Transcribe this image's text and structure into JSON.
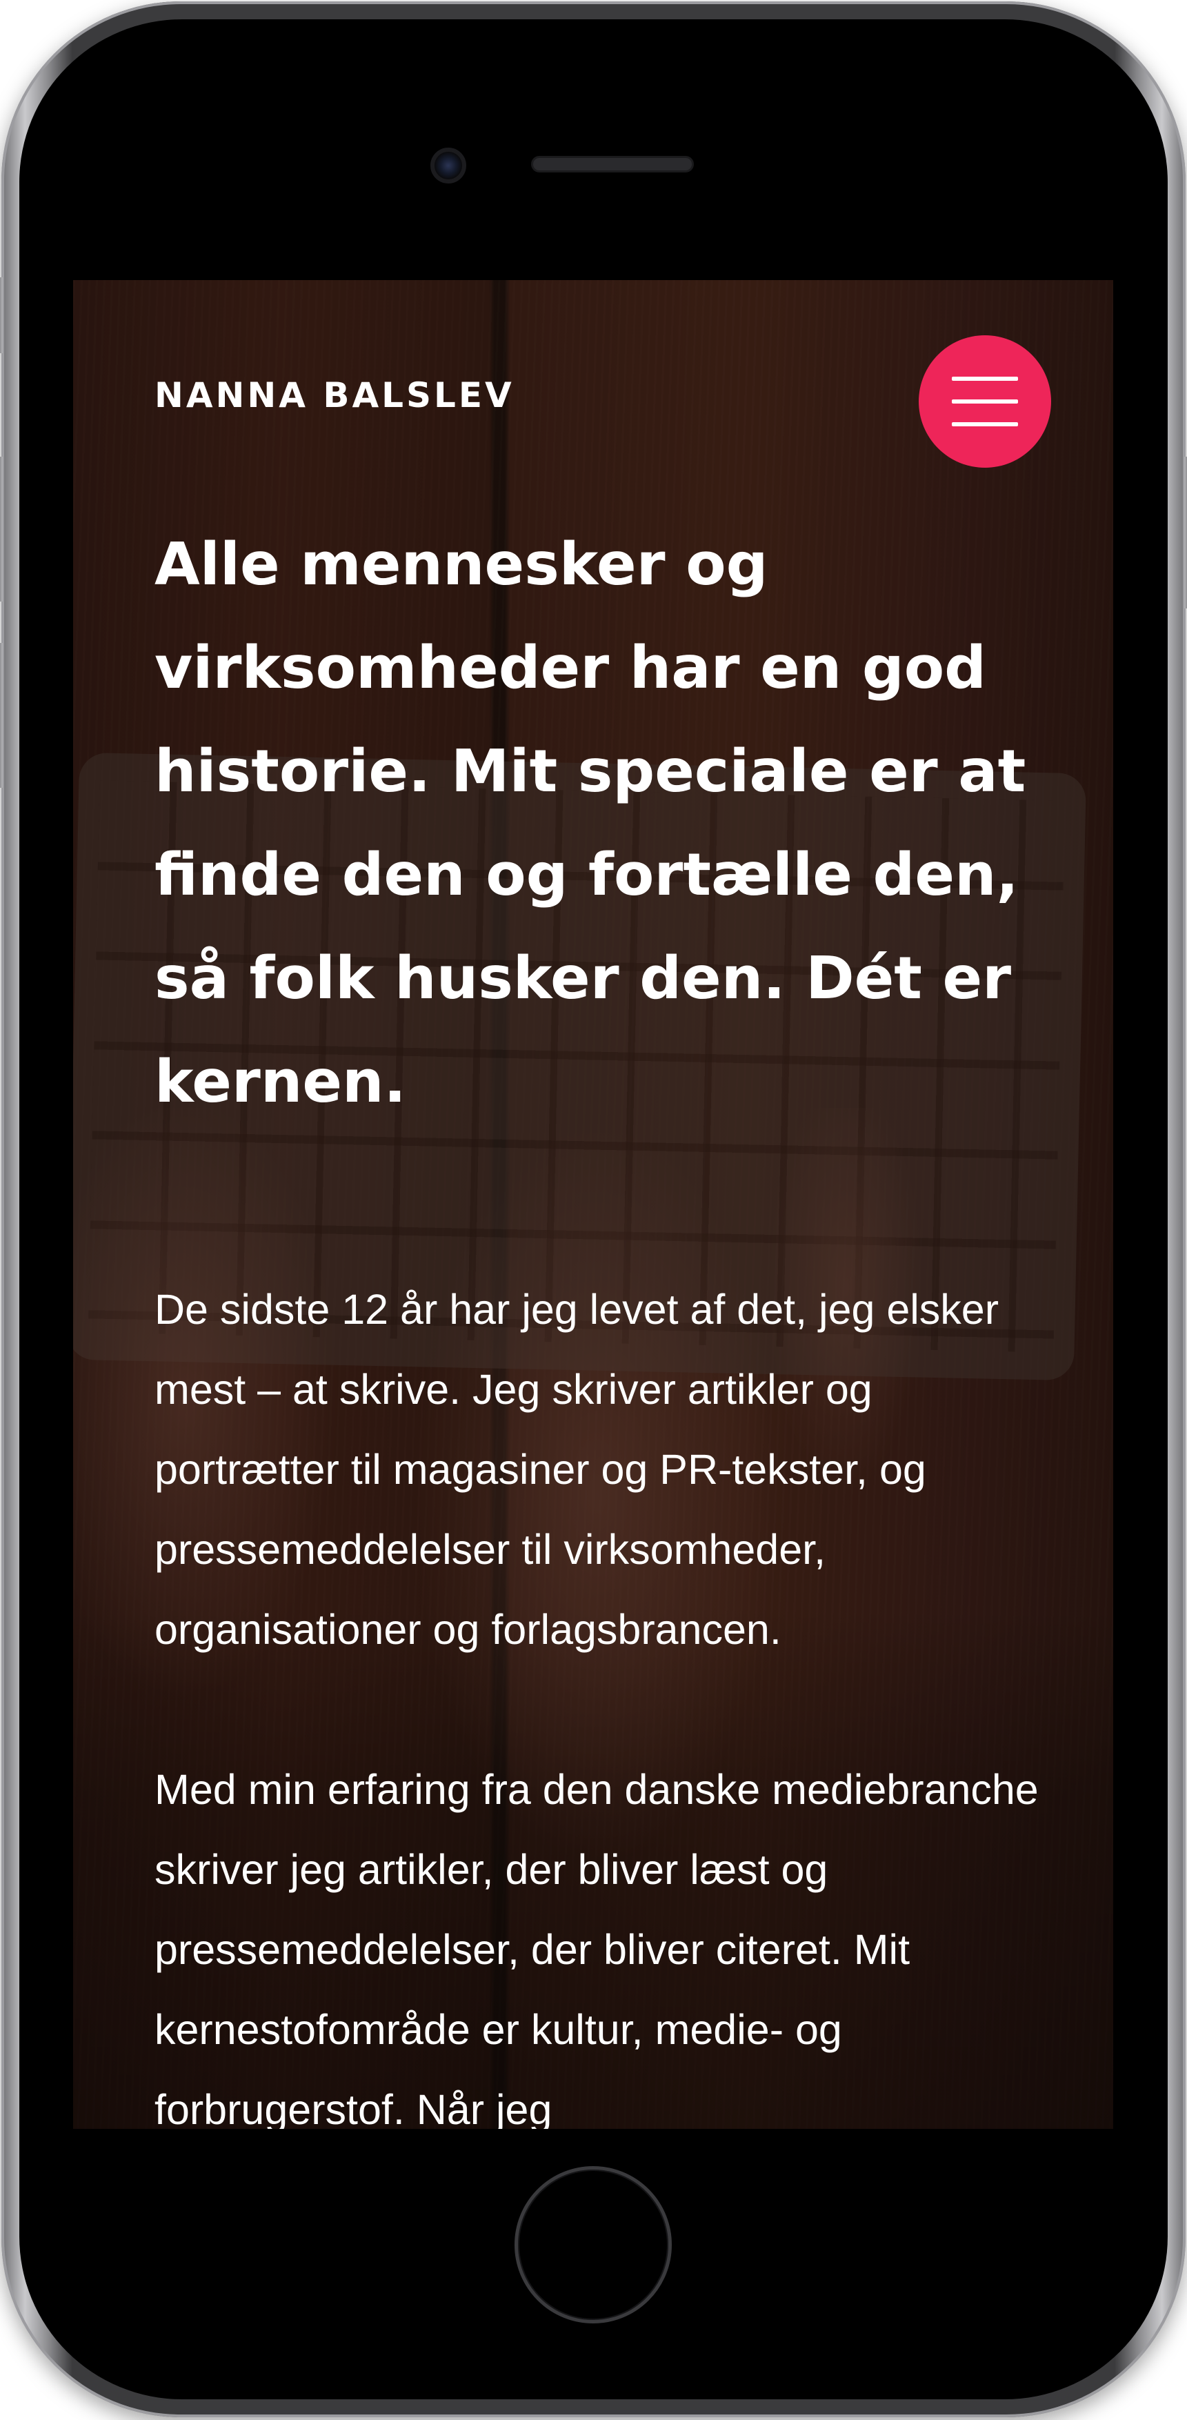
{
  "site": {
    "brand": "NANNA BALSLEV",
    "menu_icon": "hamburger-menu-icon",
    "accent_color": "#ee2559"
  },
  "hero": {
    "headline": "Alle mennesker og virksomheder har en god historie. Mit speciale er at finde den og fortælle den, så folk husker den. Dét er kernen."
  },
  "body": {
    "paragraph_1": "De sidste 12 år har jeg levet af det, jeg elsker mest – at skrive. Jeg skriver artikler og portrætter til magasiner og PR-tekster, og pressemeddelelser til virksomheder, organisationer og forlagsbrancen.",
    "paragraph_2": "Med min erfaring fra den danske mediebranche skriver jeg artikler, der bliver læst og pressemeddelelser, der bliver citeret. Mit kernestofområde er kultur, medie- og forbrugerstof. Når jeg"
  }
}
